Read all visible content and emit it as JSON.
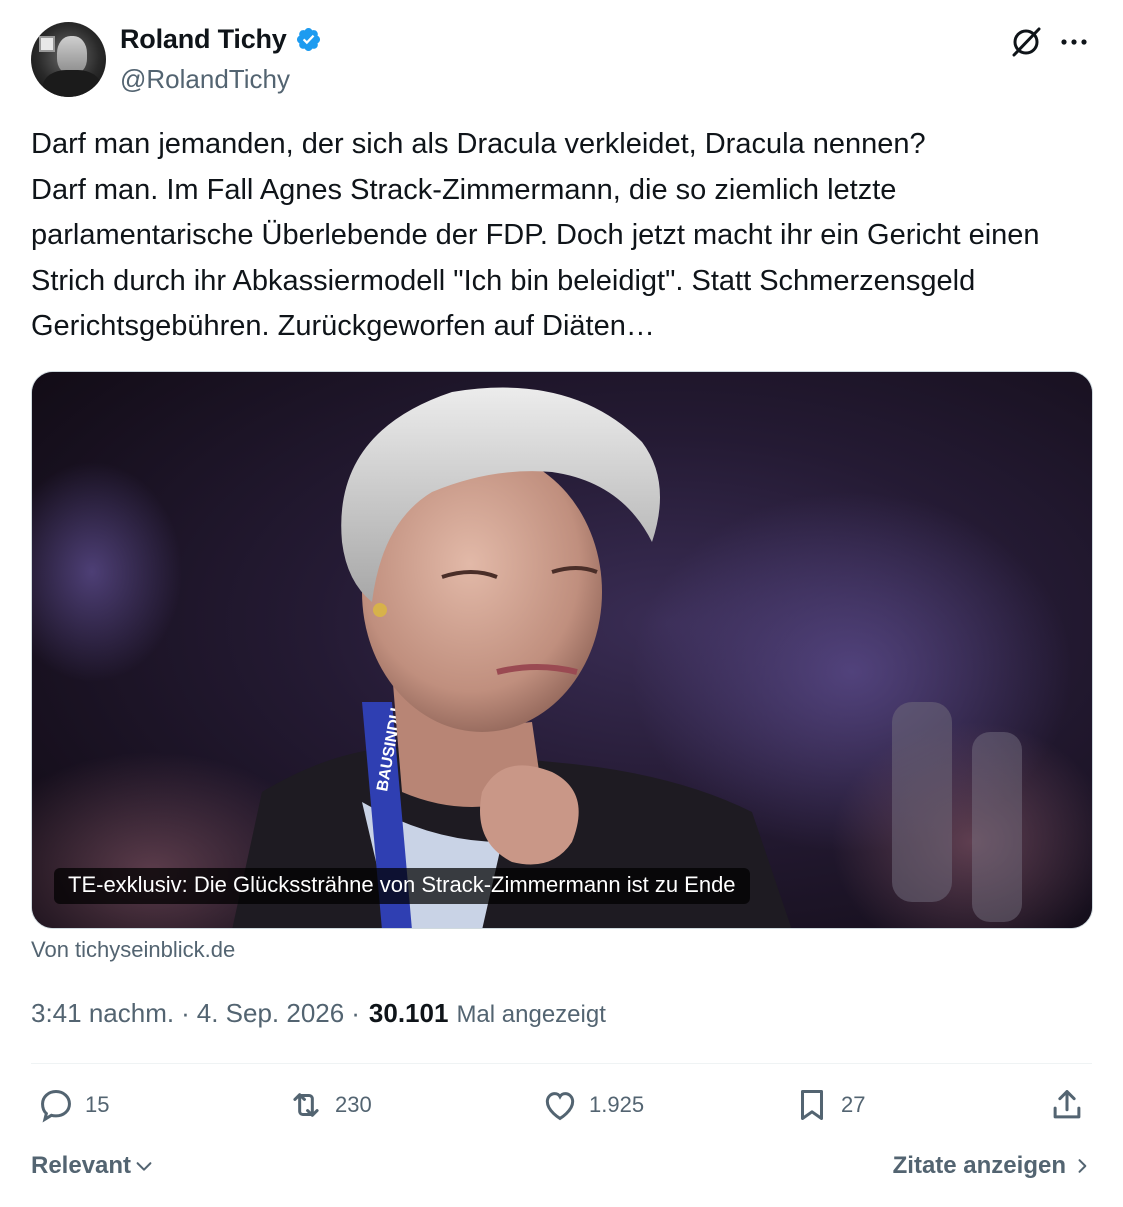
{
  "author": {
    "name": "Roland Tichy",
    "handle": "@RolandTichy",
    "verified": true
  },
  "tweet": {
    "text": "Darf man jemanden, der sich als Dracula verkleidet, Dracula nennen?\nDarf man. Im Fall Agnes Strack-Zimmermann, die so ziemlich letzte parlamentarische Überlebende der FDP. Doch jetzt macht ihr ein Gericht einen Strich durch ihr Abkassiermodell \"Ich bin beleidigt\". Statt Schmerzensgeld Gerichtsgebühren. Zurückgeworfen auf Diäten…"
  },
  "card": {
    "caption": "TE-exklusiv: Die Glückssträhne von Strack-Zimmermann ist zu Ende",
    "source": "Von tichyseinblick.de",
    "lanyard_text": "BAUSINDU"
  },
  "meta": {
    "time": "3:41 nachm.",
    "separator": "·",
    "date": "4. Sep. 2026",
    "views_count": "30.101",
    "views_label": "Mal angezeigt"
  },
  "actions": {
    "replies": "15",
    "reposts": "230",
    "likes": "1.925",
    "bookmarks": "27"
  },
  "footer": {
    "sort_label": "Relevant",
    "quotes_label": "Zitate anzeigen"
  },
  "colors": {
    "verified": "#1d9bf0",
    "text_primary": "#0f1419",
    "text_secondary": "#536471",
    "divider": "#eff3f4"
  },
  "icons": {
    "verified": "verified-badge-icon",
    "grok": "grok-icon",
    "more": "more-icon",
    "reply": "reply-icon",
    "repost": "repost-icon",
    "like": "like-icon",
    "bookmark": "bookmark-icon",
    "share": "share-icon"
  }
}
